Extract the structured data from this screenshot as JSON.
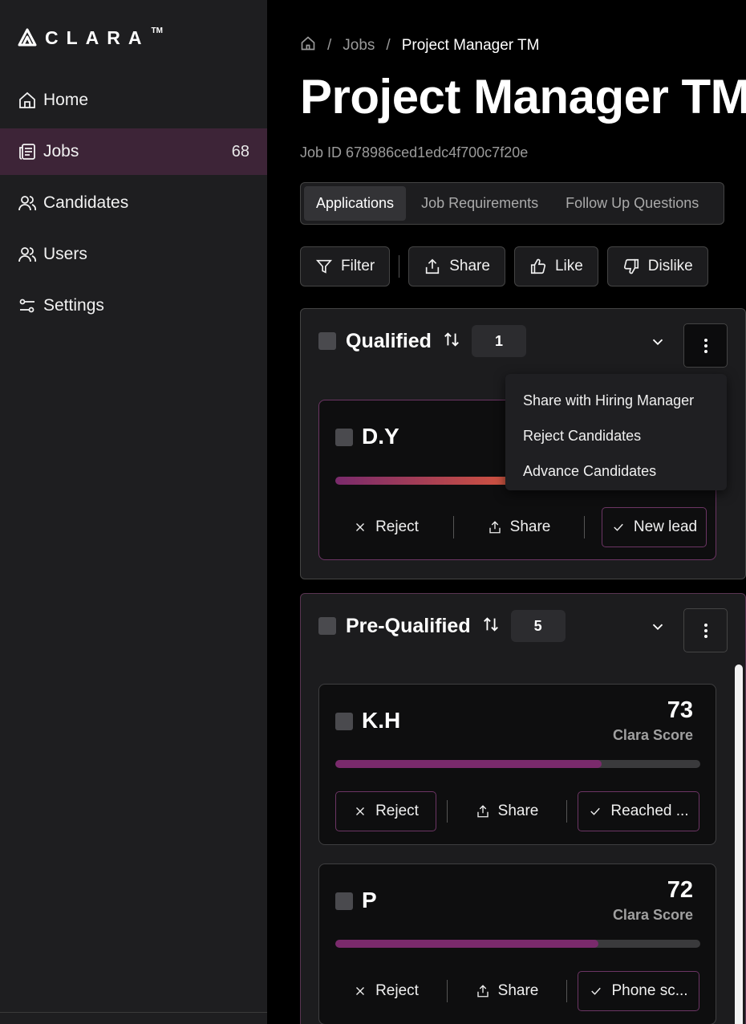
{
  "brand": {
    "name": "CLARA",
    "tm": "TM"
  },
  "sidebar": {
    "items": [
      {
        "label": "Home",
        "icon": "home-icon"
      },
      {
        "label": "Jobs",
        "icon": "newspaper-icon",
        "count": "68"
      },
      {
        "label": "Candidates",
        "icon": "users-icon"
      },
      {
        "label": "Users",
        "icon": "users-icon"
      },
      {
        "label": "Settings",
        "icon": "sliders-icon"
      }
    ]
  },
  "breadcrumb": {
    "sep": "/",
    "jobs": "Jobs",
    "current": "Project Manager TM"
  },
  "page": {
    "title": "Project Manager TM",
    "job_id": "Job ID 678986ced1edc4f700c7f20e"
  },
  "tabs": [
    "Applications",
    "Job Requirements",
    "Follow Up Questions"
  ],
  "toolbar": {
    "filter": "Filter",
    "share": "Share",
    "like": "Like",
    "dislike": "Dislike"
  },
  "menu": {
    "items": [
      "Share with Hiring Manager",
      "Reject Candidates",
      "Advance Candidates"
    ]
  },
  "stages": [
    {
      "name": "Qualified",
      "count": "1",
      "candidates": [
        {
          "name": "D.Y",
          "reject": "Reject",
          "share": "Share",
          "status": "New lead"
        }
      ]
    },
    {
      "name": "Pre-Qualified",
      "count": "5",
      "candidates": [
        {
          "name": "K.H",
          "score": "73",
          "score_label": "Clara Score",
          "score_fraction": 0.73,
          "reject": "Reject",
          "share": "Share",
          "status": "Reached ..."
        },
        {
          "name": "P",
          "score": "72",
          "score_label": "Clara Score",
          "score_fraction": 0.72,
          "reject": "Reject",
          "share": "Share",
          "status": "Phone sc..."
        }
      ]
    }
  ],
  "colors": {
    "accent": "#7a2a6c",
    "active_nav": "#3d2437",
    "sidebar": "#1e1e20"
  }
}
